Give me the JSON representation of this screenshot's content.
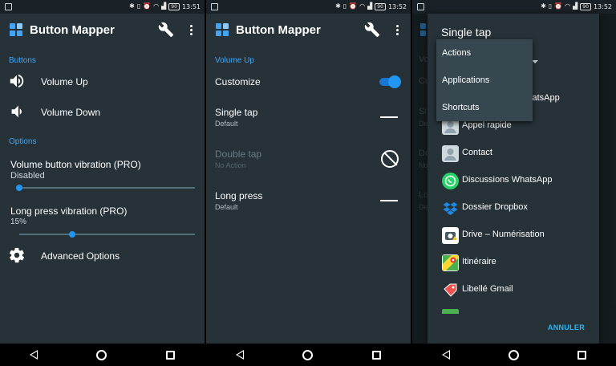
{
  "status": {
    "screen1_time": "13:51",
    "screen2_time": "13:52",
    "screen3_time": "13:52",
    "battery": "90"
  },
  "app": {
    "title": "Button Mapper"
  },
  "screen1": {
    "section_buttons": "Buttons",
    "volume_up": "Volume Up",
    "volume_down": "Volume Down",
    "section_options": "Options",
    "vibration_title": "Volume button vibration (PRO)",
    "vibration_value": "Disabled",
    "vibration_level": 0.0,
    "longpress_title": "Long press vibration (PRO)",
    "longpress_value": "15%",
    "longpress_level": 0.15,
    "advanced": "Advanced Options"
  },
  "screen2": {
    "section": "Volume Up",
    "customize": "Customize",
    "customize_on": true,
    "single_tap": "Single tap",
    "single_tap_value": "Default",
    "double_tap": "Double tap",
    "double_tap_value": "No Action",
    "long_press": "Long press",
    "long_press_value": "Default"
  },
  "screen3": {
    "dialog_title": "Single tap",
    "dropdown_options": [
      "Actions",
      "Applications",
      "Shortcuts"
    ],
    "ghost_labels": [
      "Vo",
      "Cu",
      "Si",
      "De",
      "Do",
      "No",
      "Lo",
      "De"
    ],
    "apps": [
      {
        "name": "WhatsApp",
        "icon": "whatsapp-icon",
        "color": "#25d366"
      },
      {
        "name": "Appel rapide",
        "icon": "contact-icon",
        "color": "#cfd8dc"
      },
      {
        "name": "Contact",
        "icon": "contact-icon",
        "color": "#cfd8dc"
      },
      {
        "name": "Discussions WhatsApp",
        "icon": "whatsapp-icon",
        "color": "#25d366"
      },
      {
        "name": "Dossier Dropbox",
        "icon": "dropbox-icon",
        "color": "#0061fe"
      },
      {
        "name": "Drive – Numérisation",
        "icon": "drive-scan-icon",
        "color": "#ffffff"
      },
      {
        "name": "Itinéraire",
        "icon": "maps-icon",
        "color": "#4caf50"
      },
      {
        "name": "Libellé Gmail",
        "icon": "gmail-label-icon",
        "color": "#ef5350"
      }
    ],
    "cancel": "ANNULER"
  },
  "colors": {
    "accent": "#2196f3",
    "section": "#42a5f5",
    "background": "#263238"
  }
}
